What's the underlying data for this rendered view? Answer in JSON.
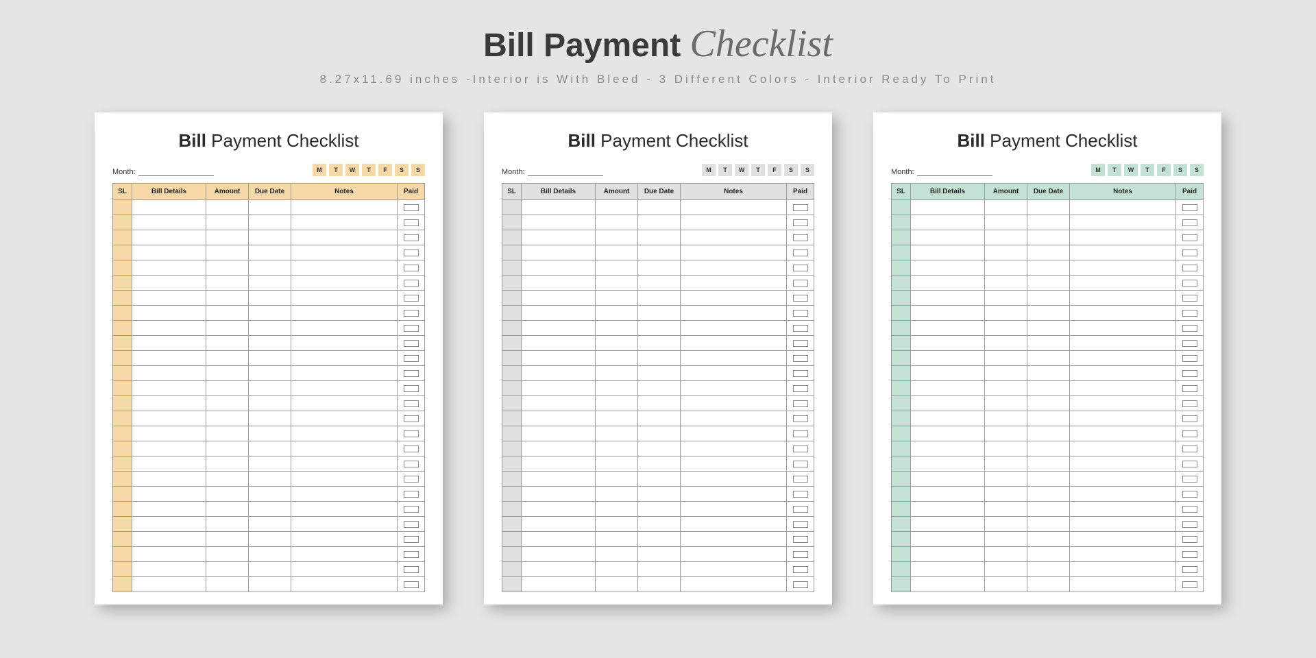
{
  "header": {
    "title_bold": "Bill Payment",
    "title_script": "Checklist",
    "subtitle": "8.27x11.69 inches -Interior is With Bleed - 3 Different Colors - Interior Ready To Print"
  },
  "sheet": {
    "title_bold": "Bill",
    "title_rest": "Payment Checklist",
    "month_label": "Month:",
    "days": [
      "M",
      "T",
      "W",
      "T",
      "F",
      "S",
      "S"
    ],
    "columns": {
      "sl": "SL",
      "details": "Bill Details",
      "amount": "Amount",
      "due": "Due Date",
      "notes": "Notes",
      "paid": "Paid"
    },
    "row_count": 26
  },
  "variants": [
    {
      "name": "orange",
      "accent": "#f6d9a6"
    },
    {
      "name": "gray",
      "accent": "#e1e1e1"
    },
    {
      "name": "green",
      "accent": "#c4e2d4"
    }
  ]
}
